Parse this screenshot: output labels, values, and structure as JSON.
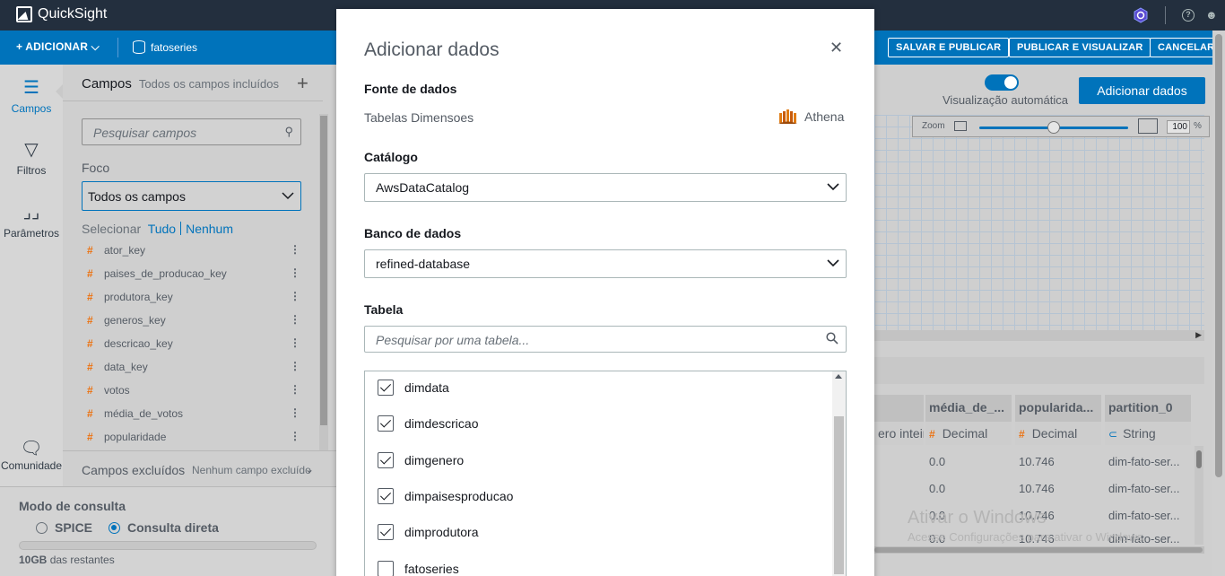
{
  "app": {
    "title": "QuickSight"
  },
  "toolbar": {
    "add_label": "+ ADICIONAR ⌵",
    "dataset": "fatoseries",
    "save_publish": "SALVAR E PUBLICAR",
    "publish_view": "PUBLICAR E VISUALIZAR",
    "cancel": "CANCELAR"
  },
  "rail": {
    "fields": "Campos",
    "filters": "Filtros",
    "params": "Parâmetros",
    "community": "Comunidade"
  },
  "fields_panel": {
    "title": "Campos",
    "subtitle": "Todos os campos incluídos",
    "search_placeholder": "Pesquisar campos",
    "focus_label": "Foco",
    "focus_value": "Todos os campos",
    "select_label": "Selecionar",
    "select_all": "Tudo",
    "select_none": "Nenhum",
    "items": [
      "ator_key",
      "paises_de_producao_key",
      "produtora_key",
      "generos_key",
      "descricao_key",
      "data_key",
      "votos",
      "média_de_votos",
      "popularidade"
    ],
    "excluded_title": "Campos excluídos",
    "excluded_sub": "Nenhum campo excluído"
  },
  "query_mode": {
    "title": "Modo de consulta",
    "spice": "SPICE",
    "direct": "Consulta direta",
    "remaining_bold": "10GB",
    "remaining_rest": " das restantes"
  },
  "right_panel": {
    "auto_vis": "Visualização automática",
    "add_data_btn": "Adicionar dados",
    "zoom_label": "Zoom",
    "zoom_value": "100",
    "zoom_unit": "%"
  },
  "data_table": {
    "columns": [
      {
        "header": "",
        "type": "ero inteir",
        "type_icon": ""
      },
      {
        "header": "média_de_...",
        "type": "Decimal",
        "type_icon": "#"
      },
      {
        "header": "popularida...",
        "type": "Decimal",
        "type_icon": "#"
      },
      {
        "header": "partition_0",
        "type": "String",
        "type_icon": "⊂"
      }
    ],
    "rows": [
      [
        "0.0",
        "10.746",
        "dim-fato-ser..."
      ],
      [
        "0.0",
        "10.746",
        "dim-fato-ser..."
      ],
      [
        "0.0",
        "10.746",
        "dim-fato-ser..."
      ],
      [
        "0.0",
        "10.746",
        "dim-fato-ser..."
      ]
    ]
  },
  "watermark": {
    "line1": "Ativar o Windows",
    "line2": "Acesse Configurações para ativar o Windows."
  },
  "modal": {
    "title": "Adicionar dados",
    "source_label": "Fonte de dados",
    "source_name": "Tabelas Dimensoes",
    "source_type": "Athena",
    "catalog_label": "Catálogo",
    "catalog_value": "AwsDataCatalog",
    "db_label": "Banco de dados",
    "db_value": "refined-database",
    "table_label": "Tabela",
    "table_placeholder": "Pesquisar por uma tabela...",
    "tables": [
      {
        "name": "dimdata",
        "checked": true
      },
      {
        "name": "dimdescricao",
        "checked": true
      },
      {
        "name": "dimgenero",
        "checked": true
      },
      {
        "name": "dimpaisesproducao",
        "checked": true
      },
      {
        "name": "dimprodutora",
        "checked": true
      },
      {
        "name": "fatoseries",
        "checked": false
      }
    ]
  },
  "colors": {
    "brand_dark": "#232f3e",
    "accent": "#0073bb",
    "field_hash": "#ec7211"
  },
  "icons": [
    "chart-logo-icon",
    "hexagon-icon",
    "help-icon",
    "user-icon",
    "database-icon",
    "fields-icon",
    "filter-icon",
    "params-icon",
    "community-icon",
    "search-icon",
    "chevron-down-icon",
    "close-icon",
    "athena-icon",
    "checkbox-icon"
  ]
}
